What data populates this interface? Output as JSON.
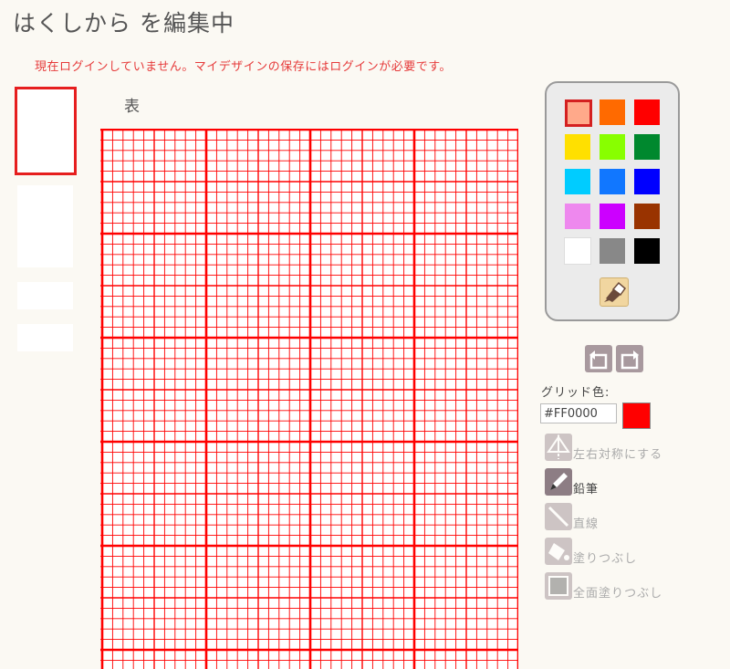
{
  "header": {
    "title": "はくしから を編集中",
    "login_notice": "現在ログインしていません。マイデザインの保存にはログインが必要です。"
  },
  "editor": {
    "side_label": "表",
    "grid": {
      "cell_count": 40,
      "major_every": 10,
      "mid_every": 5,
      "color": "#FF0000"
    }
  },
  "palette": {
    "colors": [
      "#FFA98A",
      "#FF6A00",
      "#FF0000",
      "#FFE000",
      "#88FF00",
      "#00882E",
      "#00CCFF",
      "#1177FF",
      "#0000FF",
      "#EE88EE",
      "#CC00FF",
      "#993300",
      "#FFFFFF",
      "#888888",
      "#000000"
    ],
    "selected_index": 0,
    "brush_icon": "paint-tube-icon"
  },
  "history": {
    "undo_icon": "undo-arrow-icon",
    "redo_icon": "redo-arrow-icon"
  },
  "grid_color": {
    "label": "グリッド色:",
    "value": "#FF0000"
  },
  "tools": [
    {
      "label": "左右対称にする",
      "icon": "mirror-icon",
      "active": false
    },
    {
      "label": "鉛筆",
      "icon": "pencil-icon",
      "active": true
    },
    {
      "label": "直線",
      "icon": "line-icon",
      "active": false
    },
    {
      "label": "塗りつぶし",
      "icon": "bucket-icon",
      "active": false
    },
    {
      "label": "全面塗りつぶし",
      "icon": "fill-square-icon",
      "active": false
    }
  ]
}
